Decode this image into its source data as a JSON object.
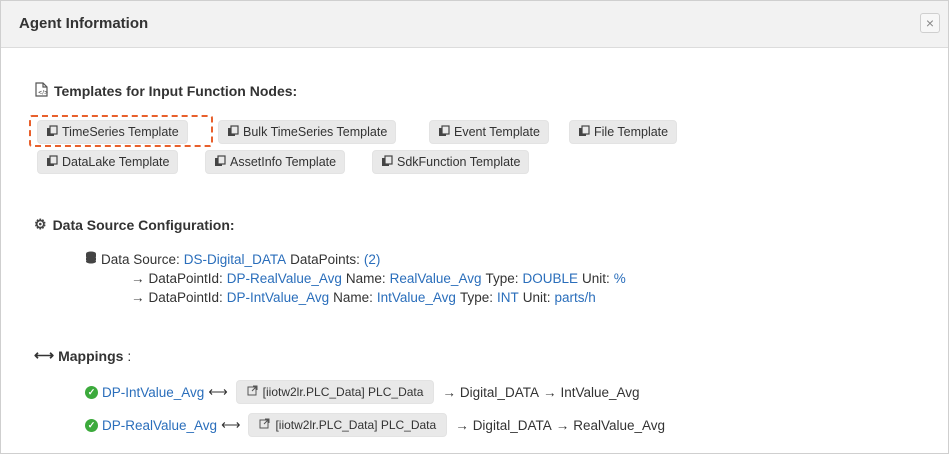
{
  "dialog": {
    "title": "Agent Information",
    "close_label": "×"
  },
  "templates": {
    "heading": "Templates for Input Function Nodes:",
    "buttons": [
      "TimeSeries Template",
      "Bulk TimeSeries Template",
      "Event Template",
      "File Template",
      "DataLake Template",
      "AssetInfo Template",
      "SdkFunction Template"
    ]
  },
  "datasource": {
    "heading": "Data Source Configuration:",
    "source_label": "Data Source:",
    "source_name": "DS-Digital_DATA",
    "datapoints_label": "DataPoints:",
    "datapoints_count": "(2)",
    "points": [
      {
        "id_label": "DataPointId:",
        "id": "DP-RealValue_Avg",
        "name_label": "Name:",
        "name": "RealValue_Avg",
        "type_label": "Type:",
        "type": "DOUBLE",
        "unit_label": "Unit:",
        "unit": "%"
      },
      {
        "id_label": "DataPointId:",
        "id": "DP-IntValue_Avg",
        "name_label": "Name:",
        "name": "IntValue_Avg",
        "type_label": "Type:",
        "type": "INT",
        "unit_label": "Unit:",
        "unit": "parts/h"
      }
    ]
  },
  "mappings": {
    "heading": "Mappings",
    "colon": ":",
    "rows": [
      {
        "source": "DP-IntValue_Avg",
        "chip": "[iiotw2lr.PLC_Data] PLC_Data",
        "target": "Digital_DATA",
        "value": "IntValue_Avg"
      },
      {
        "source": "DP-RealValue_Avg",
        "chip": "[iiotw2lr.PLC_Data] PLC_Data",
        "target": "Digital_DATA",
        "value": "RealValue_Avg"
      }
    ]
  },
  "colors": {
    "link": "#2a6ebb",
    "highlight": "#e8602c",
    "check": "#3caa3c"
  }
}
